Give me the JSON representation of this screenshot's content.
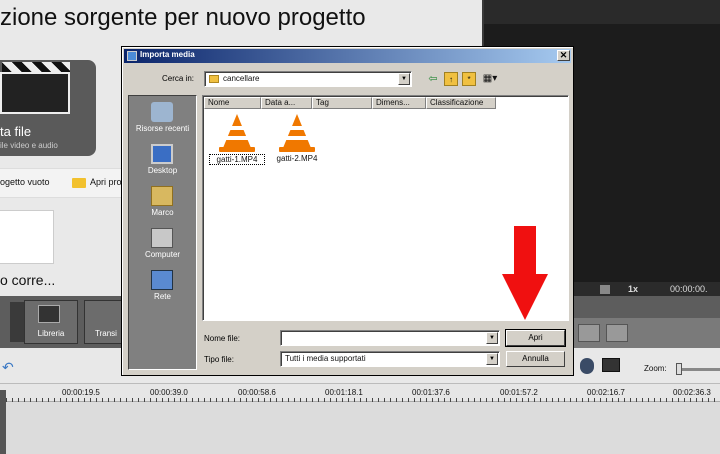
{
  "background_app": {
    "title": "zione sorgente per nuovo progetto",
    "card_title": "ta file",
    "card_subtitle": "ile video e audio",
    "row_left": "ogetto vuoto",
    "row_right": "Apri pro",
    "doc_label": "o corre...",
    "toolbar": {
      "library_label": "Libreria",
      "transitions_label": "Transi"
    },
    "player": {
      "speed": "1x",
      "time": "00:00:00."
    },
    "zoom_label": "Zoom:",
    "ruler": [
      "00:00:19.5",
      "00:00:39.0",
      "00:00:58.6",
      "00:01:18.1",
      "00:01:37.6",
      "00:01:57.2",
      "00:02:16.7",
      "00:02:36.3"
    ]
  },
  "dialog": {
    "title": "Importa media",
    "look_in_label": "Cerca in:",
    "look_in_value": "cancellare",
    "places": [
      {
        "label": "Risorse recenti",
        "icon": "recent-icon"
      },
      {
        "label": "Desktop",
        "icon": "desktop-icon"
      },
      {
        "label": "Marco",
        "icon": "user-folder-icon"
      },
      {
        "label": "Computer",
        "icon": "computer-icon"
      },
      {
        "label": "Rete",
        "icon": "network-icon"
      }
    ],
    "columns": [
      "Nome",
      "Data a...",
      "Tag",
      "Dimens...",
      "Classificazione"
    ],
    "files": [
      {
        "name": "gatti-1.MP4",
        "icon": "vlc-cone-icon",
        "selected": true
      },
      {
        "name": "gatti-2.MP4",
        "icon": "vlc-cone-icon",
        "selected": false
      }
    ],
    "filename_label": "Nome file:",
    "filename_value": "",
    "filetype_label": "Tipo file:",
    "filetype_value": "Tutti i media supportati",
    "open_button": "Apri",
    "cancel_button": "Annulla",
    "close_glyph": "✕"
  },
  "colors": {
    "arrow": "#f01010",
    "title_bar_start": "#0a246a",
    "title_bar_end": "#a6caf0",
    "vlc_orange": "#f07800"
  }
}
